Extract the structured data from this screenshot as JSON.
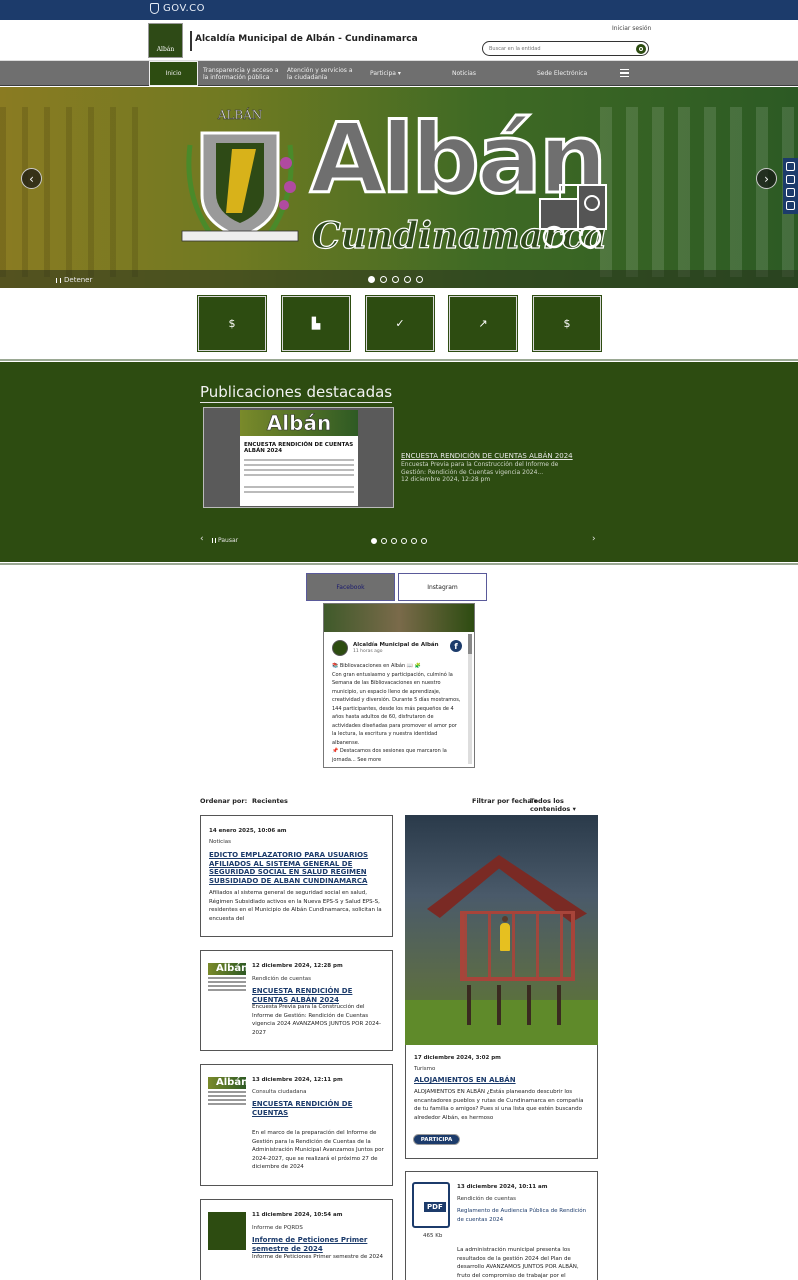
{
  "gov_bar": {
    "label": "GOV.CO"
  },
  "header": {
    "logo_text": "Albán",
    "site_title": "Alcaldía Municipal de Albán - Cundinamarca",
    "login": "Iniciar sesión",
    "search_placeholder": "Buscar en la entidad"
  },
  "nav": {
    "items": [
      {
        "label": "Inicio"
      },
      {
        "label": "Transparencia y acceso a la información pública"
      },
      {
        "label": "Atención y servicios a la ciudadanía"
      },
      {
        "label": "Participa"
      },
      {
        "label": "Noticias"
      },
      {
        "label": "Sede Electrónica"
      }
    ]
  },
  "hero": {
    "crest_text": "ALBÁN",
    "title": "Albán",
    "subtitle": "Cundinamarca",
    "stop_label": "Detener",
    "slides": 5,
    "active_slide": 1
  },
  "tiles": [
    {
      "icon": "money-icon",
      "glyph": "$"
    },
    {
      "icon": "building-icon",
      "glyph": "▙"
    },
    {
      "icon": "check-icon",
      "glyph": "✓"
    },
    {
      "icon": "chart-up-icon",
      "glyph": "↗"
    },
    {
      "icon": "money-icon",
      "glyph": "$"
    }
  ],
  "publications": {
    "heading": "Publicaciones destacadas",
    "thumb_banner": "Albán",
    "thumb_doc_title": "ENCUESTA RENDICIÓN DE CUENTAS ALBÁN 2024",
    "title": "ENCUESTA RENDICIÓN DE CUENTAS ALBÁN 2024",
    "desc": "Encuesta Previa para la Construcción del Informe de Gestión: Rendición de Cuentas vigencia 2024...",
    "date": "12 diciembre 2024, 12:28 pm",
    "pause_label": "Pausar",
    "slides": 6,
    "active_slide": 1
  },
  "social": {
    "tab_facebook": "Facebook",
    "tab_instagram": "Instagram",
    "fb_page_name": "Alcaldía Municipal de Albán",
    "fb_time": "11 horas ago",
    "fb_text_1": "📚 Bibliovacaciones en Albán 📖 🧩",
    "fb_text_2": "Con gran entusiasmo y participación, culminó la Semana de las Bibliovacaciones en nuestro municipio, un espacio lleno de aprendizaje, creatividad y diversión. Durante 5 días mostramos, 144 participantes, desde los más pequeños de 4 años hasta adultos de 60, disfrutaron de actividades diseñadas para promover el amor por la lectura, la escritura y nuestra identidad albanense.",
    "fb_text_3": "📌 Destacamos dos sesiones que marcaron la jornada... See more"
  },
  "feed": {
    "sort_label": "Ordenar por:",
    "sort_value": "Recientes",
    "filter_date": "Filtrar por fecha",
    "filter_type": "Todos los contenidos",
    "cards": [
      {
        "date": "14 enero 2025, 10:06 am",
        "category": "Noticias",
        "title": "EDICTO EMPLAZATORIO PARA USUARIOS AFILIADOS AL SISTEMA GENERAL DE SEGURIDAD SOCIAL EN SALUD REGIMEN SUBSIDIADO DE ALBAN CUNDINAMARCA",
        "body": "Afiliados al sistema general de seguridad social en salud, Régimen Subsidiado activos en la Nueva EPS-S y Salud EPS-S, residentes en el Municipio de Albán Cundinamarca, solicitan la encuesta del"
      },
      {
        "date": "12 diciembre 2024, 12:28 pm",
        "category": "Rendición de cuentas",
        "title": "ENCUESTA RENDICIÓN DE CUENTAS ALBÁN 2024",
        "body": "Encuesta Previa para la Construcción del Informe de Gestión: Rendición de Cuentas vigencia 2024 AVANZAMOS JUNTOS POR 2024-2027"
      },
      {
        "date": "13 diciembre 2024, 12:11 pm",
        "category": "Consulta ciudadana",
        "title": "ENCUESTA RENDICIÓN DE CUENTAS",
        "body": "En el marco de la preparación del Informe de Gestión para la Rendición de Cuentas de la Administración Municipal Avanzamos Juntos por 2024-2027, que se realizará el próximo 27 de diciembre de 2024"
      },
      {
        "date": "11 diciembre 2024, 10:54 am",
        "category": "Informe de PQRDS",
        "title": "Informe de Peticiones Primer semestre de 2024",
        "body": "Informe de Peticiones Primer semestre de 2024"
      },
      {
        "date": "17 diciembre 2024, 3:02 pm",
        "category": "Turismo",
        "title": "ALOJAMIENTOS EN ALBÁN",
        "body": "ALOJAMIENTOS EN ALBÁN ¿Estás planeando descubrir los encantadores pueblos y rutas de Cundinamarca en compañía de tu familia o amigos? Pues si una lista que estén buscando alrededor Albán, es hermoso",
        "button": "PARTICIPA"
      },
      {
        "date": "13 diciembre 2024, 10:11 am",
        "category": "Rendición de cuentas",
        "title": "Reglamento de Audiencia Pública de Rendición de cuentas 2024",
        "body": "La administración municipal presenta los resultados de la gestión 2024 del Plan de desarrollo AVANZAMOS JUNTOS POR ALBÁN, fruto del compromiso de trabajar por el",
        "file_size": "465 Kb"
      }
    ]
  }
}
